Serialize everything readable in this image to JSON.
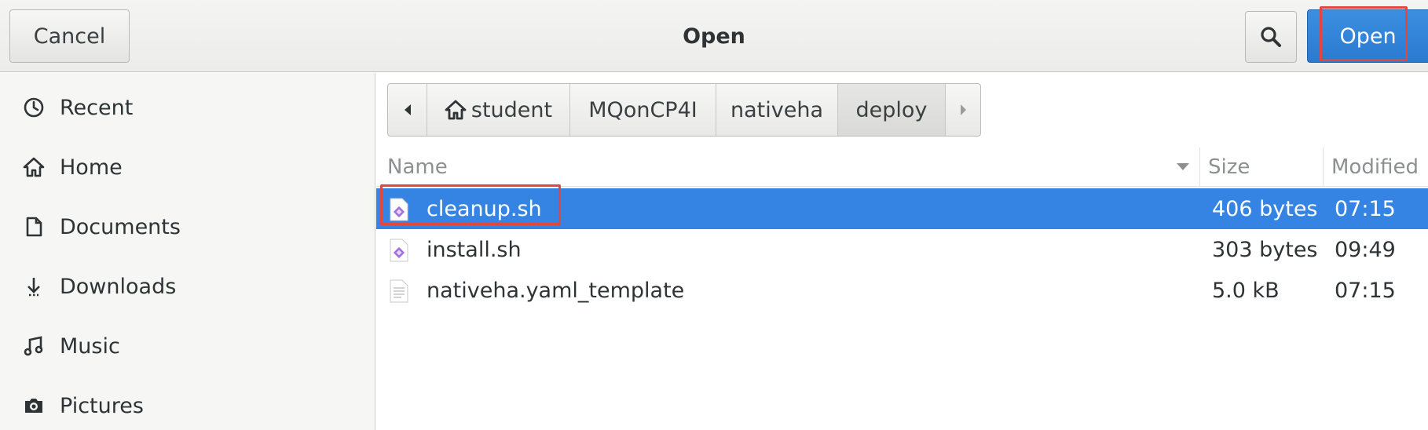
{
  "header": {
    "title": "Open",
    "cancel_label": "Cancel",
    "open_label": "Open",
    "search_icon": "search-icon"
  },
  "sidebar": {
    "items": [
      {
        "label": "Recent",
        "icon": "clock-icon"
      },
      {
        "label": "Home",
        "icon": "home-icon"
      },
      {
        "label": "Documents",
        "icon": "document-icon"
      },
      {
        "label": "Downloads",
        "icon": "download-icon"
      },
      {
        "label": "Music",
        "icon": "music-icon"
      },
      {
        "label": "Pictures",
        "icon": "camera-icon"
      }
    ]
  },
  "pathbar": {
    "segments": [
      "student",
      "MQonCP4I",
      "nativeha",
      "deploy"
    ],
    "active": "deploy"
  },
  "filelist": {
    "columns": {
      "name": "Name",
      "size": "Size",
      "modified": "Modified"
    },
    "rows": [
      {
        "name": "cleanup.sh",
        "size": "406 bytes",
        "modified": "07:15",
        "icon": "script-file-icon",
        "selected": true
      },
      {
        "name": "install.sh",
        "size": "303 bytes",
        "modified": "09:49",
        "icon": "script-file-icon",
        "selected": false
      },
      {
        "name": "nativeha.yaml_template",
        "size": "5.0 kB",
        "modified": "07:15",
        "icon": "text-file-icon",
        "selected": false
      }
    ]
  },
  "colors": {
    "accent": "#3584e4",
    "highlight_annotation": "#e2473f"
  }
}
